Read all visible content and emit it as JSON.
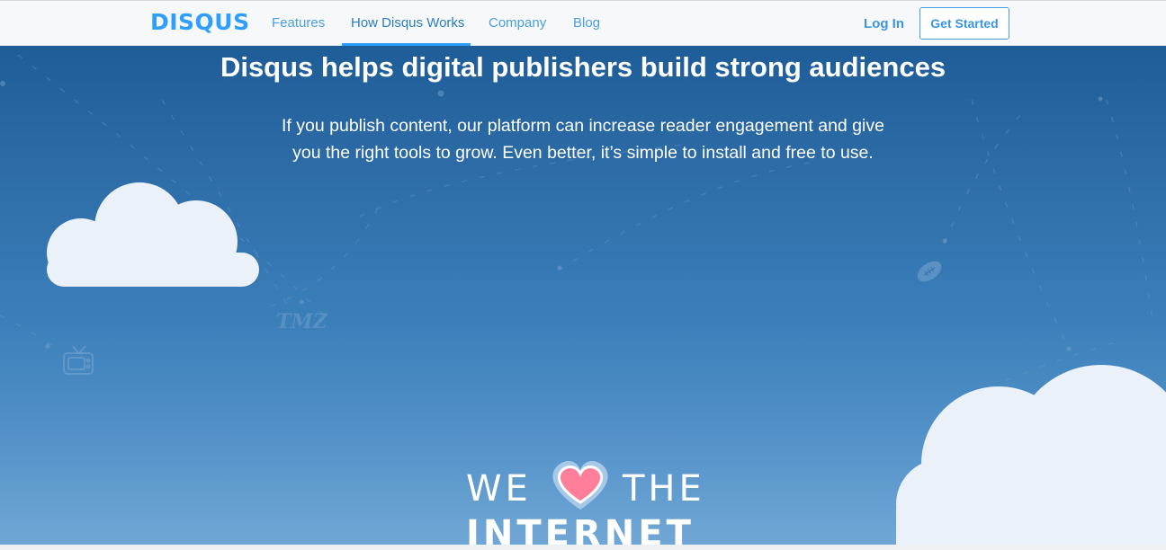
{
  "nav": {
    "logo": "DISQUS",
    "links": [
      {
        "label": "Features"
      },
      {
        "label": "How Disqus Works"
      },
      {
        "label": "Company"
      },
      {
        "label": "Blog"
      }
    ],
    "login": "Log In",
    "cta": "Get Started",
    "active_link": "How Disqus Works"
  },
  "hero": {
    "title": "Disqus helps digital publishers build strong audiences",
    "subtitle_line1": "If you publish content, our platform can increase reader engagement and give",
    "subtitle_line2": "you the right tools to grow. Even better, it’s simple to install and free to use.",
    "we": "WE",
    "the": "THE",
    "internet": "INTERNET",
    "tmz_logo": "TMZ",
    "icons": [
      "cloud-icon",
      "tv-icon",
      "football-icon",
      "heart-icon"
    ]
  },
  "colors": {
    "brand": "#2e9fff",
    "hero_top": "#1f5d98",
    "hero_bottom": "#71a7d6",
    "cloud": "#eaf1f8",
    "heart": "#ff7f9b"
  }
}
